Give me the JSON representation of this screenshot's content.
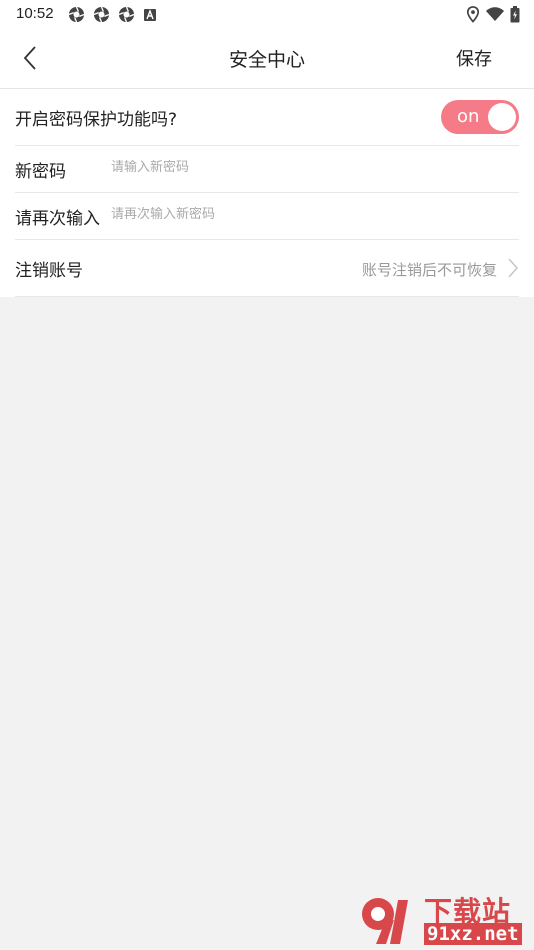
{
  "status_bar": {
    "time": "10:52",
    "left_icons": [
      "aperture-icon",
      "aperture-icon",
      "aperture-icon",
      "a-notification-icon"
    ],
    "right_icons": [
      "location-icon",
      "wifi-icon",
      "battery-icon"
    ]
  },
  "nav": {
    "back_icon": "chevron-left-icon",
    "title": "安全中心",
    "save_label": "保存"
  },
  "settings": {
    "password_protection": {
      "label": "开启密码保护功能吗?",
      "toggle_text": "on",
      "toggle_on": true,
      "toggle_color": "#f47b87"
    },
    "new_password": {
      "label": "新密码",
      "value": "",
      "placeholder": "请输入新密码"
    },
    "repeat_password": {
      "label": "请再次输入",
      "value": "",
      "placeholder": "请再次输入新密码"
    },
    "logout_account": {
      "label": "注销账号",
      "hint": "账号注销后不可恢复",
      "chevron_icon": "chevron-right-icon"
    }
  },
  "watermark": {
    "title": "下载站",
    "url": "91xz.net",
    "color": "#d8474a"
  }
}
